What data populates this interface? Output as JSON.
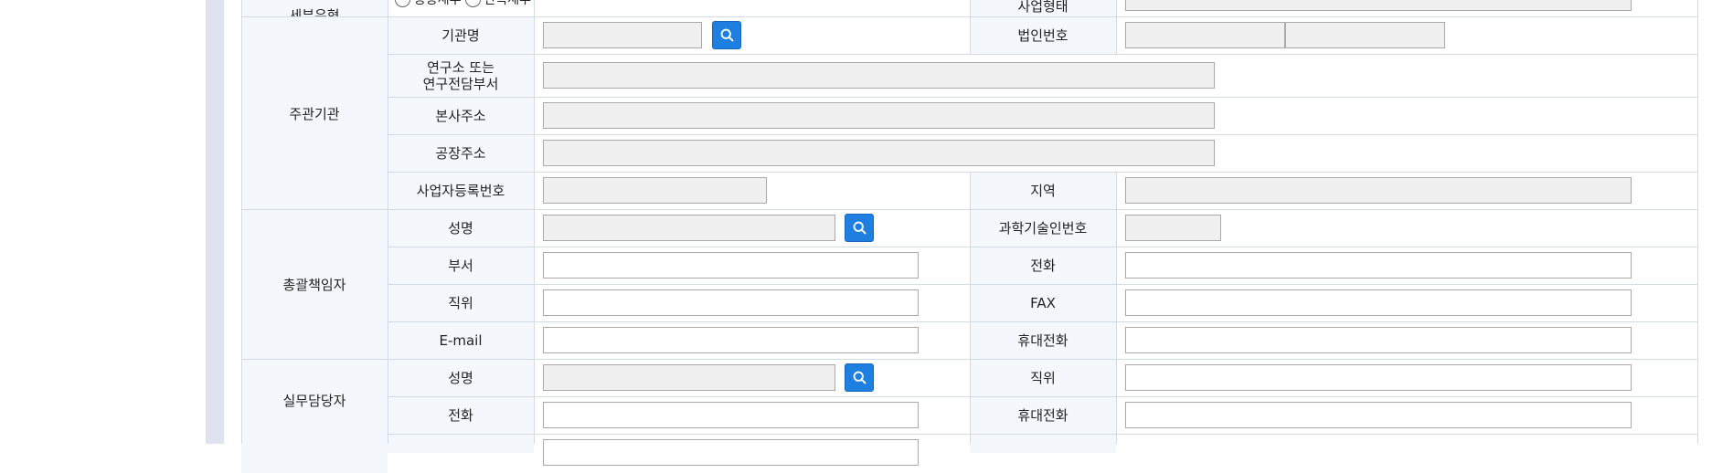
{
  "form": {
    "top_row": {
      "label_left": "세부유형",
      "radio_1": "공동세부",
      "radio_2": "단독세부",
      "label_right": "사업형태"
    },
    "organizer": {
      "group": "주관기관",
      "org_name_label": "기관명",
      "corp_no_label": "법인번호",
      "lab_label_line1": "연구소 또는",
      "lab_label_line2": "연구전담부서",
      "hq_address_label": "본사주소",
      "factory_address_label": "공장주소",
      "biz_reg_label": "사업자등록번호",
      "region_label": "지역"
    },
    "head": {
      "group": "총괄책임자",
      "name_label": "성명",
      "sci_no_label": "과학기술인번호",
      "dept_label": "부서",
      "phone_label": "전화",
      "position_label": "직위",
      "fax_label": "FAX",
      "email_label": "E-mail",
      "mobile_label": "휴대전화"
    },
    "staff": {
      "group": "실무담당자",
      "name_label": "성명",
      "position_label": "직위",
      "phone_label": "전화",
      "mobile_label": "휴대전화"
    }
  },
  "colors": {
    "label_bg": "#f4f8fc",
    "border": "#d3dbe6",
    "readonly_bg": "#f0f0f0",
    "button": "#1e7fe0",
    "frame": "#dfe3ef"
  },
  "icons": {
    "search": "search-icon"
  }
}
